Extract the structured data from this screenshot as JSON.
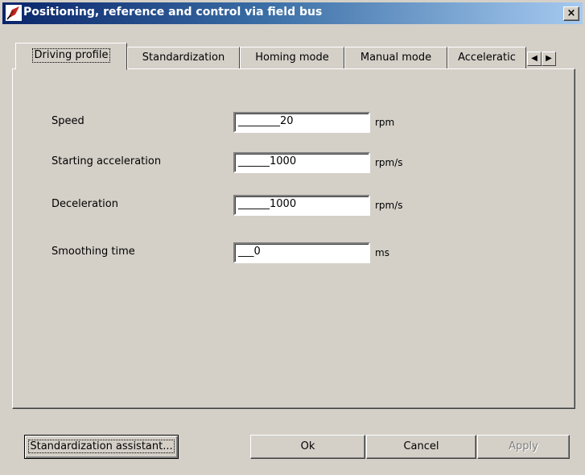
{
  "window": {
    "title": "Positioning, reference and control via field bus",
    "close_label": "×"
  },
  "tabs": [
    {
      "label": "Driving profile",
      "active": true
    },
    {
      "label": "Standardization",
      "active": false
    },
    {
      "label": "Homing mode",
      "active": false
    },
    {
      "label": "Manual mode",
      "active": false
    },
    {
      "label": "Acceleratic",
      "active": false
    }
  ],
  "tab_scroll": {
    "left": "◀",
    "right": "▶"
  },
  "fields": [
    {
      "label": "Speed",
      "value": "________20",
      "unit": "rpm"
    },
    {
      "label": "Starting acceleration",
      "value": "______1000",
      "unit": "rpm/s"
    },
    {
      "label": "Deceleration",
      "value": "______1000",
      "unit": "rpm/s"
    },
    {
      "label": "Smoothing time",
      "value": "___0",
      "unit": "ms"
    }
  ],
  "buttons": {
    "assistant": "Standardization assistant...",
    "ok": "Ok",
    "cancel": "Cancel",
    "apply": "Apply"
  }
}
